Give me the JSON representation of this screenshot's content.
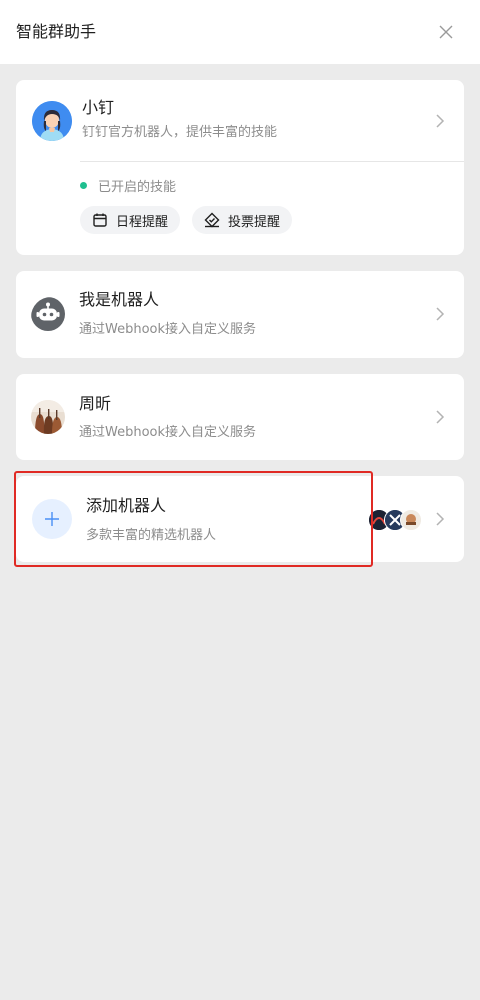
{
  "header": {
    "title": "智能群助手"
  },
  "assistant": {
    "name": "小钉",
    "description": "钉钉官方机器人，提供丰富的技能",
    "status": "已开启的技能",
    "skills": [
      {
        "label": "日程提醒",
        "icon": "calendar-icon"
      },
      {
        "label": "投票提醒",
        "icon": "vote-icon"
      }
    ]
  },
  "robots": [
    {
      "name": "我是机器人",
      "description": "通过Webhook接入自定义服务",
      "avatar": "robot-icon"
    },
    {
      "name": "周昕",
      "description": "通过Webhook接入自定义服务",
      "avatar": "photo"
    }
  ],
  "add_robot": {
    "title": "添加机器人",
    "description": "多款丰富的精选机器人"
  },
  "colors": {
    "accent": "#1fbf8f",
    "add_blue": "#4a90f5",
    "highlight": "#e02a24"
  }
}
